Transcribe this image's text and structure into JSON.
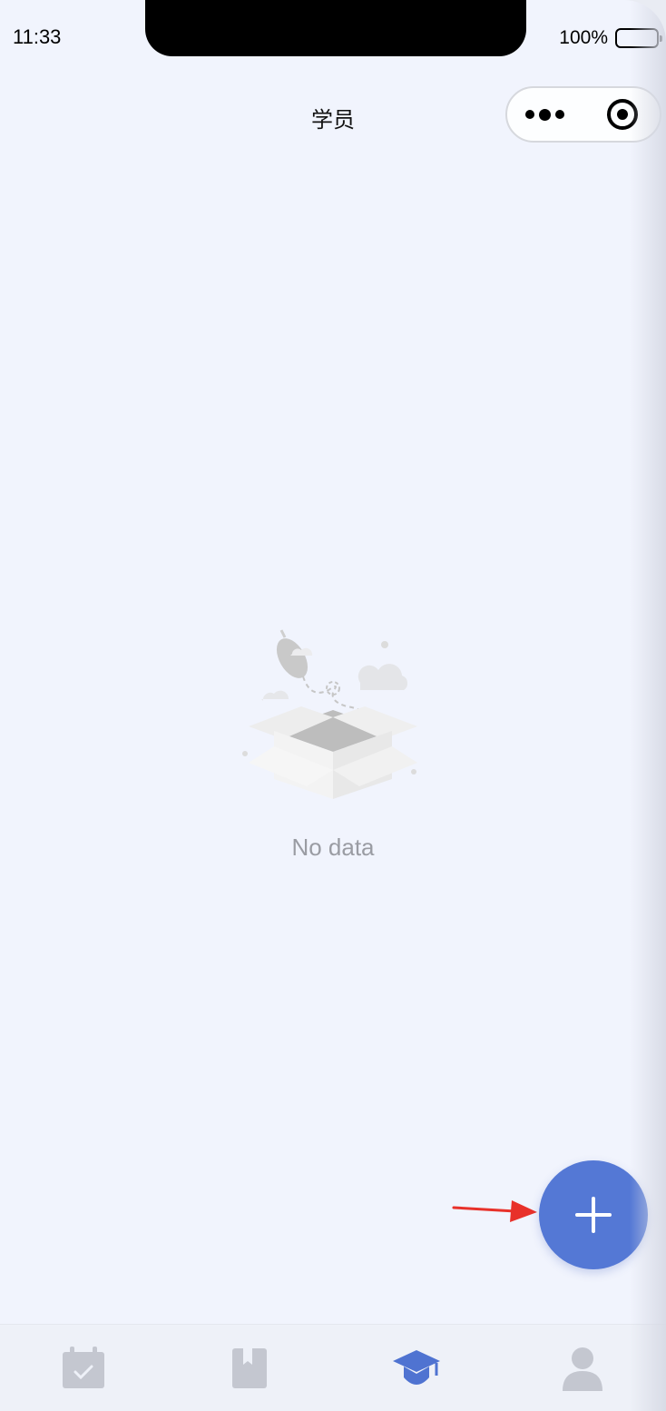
{
  "status_bar": {
    "time": "11:33",
    "battery_percent": "100%"
  },
  "nav": {
    "title": "学员",
    "capsule": {
      "more_icon": "more-dots-icon",
      "close_icon": "target-circle-icon"
    }
  },
  "empty_state": {
    "illustration_icon": "empty-box-icon",
    "text": "No data"
  },
  "fab": {
    "icon": "plus-icon",
    "color": "#5478d5"
  },
  "annotation": {
    "icon": "red-arrow-icon",
    "color": "#e8312a"
  },
  "tabbar": {
    "tabs": [
      {
        "icon": "calendar-check-icon",
        "active": false
      },
      {
        "icon": "bookmark-book-icon",
        "active": false
      },
      {
        "icon": "graduation-cap-icon",
        "active": true
      },
      {
        "icon": "person-icon",
        "active": false
      }
    ],
    "active_color": "#4f73d1",
    "inactive_color": "#c4c7d0"
  }
}
